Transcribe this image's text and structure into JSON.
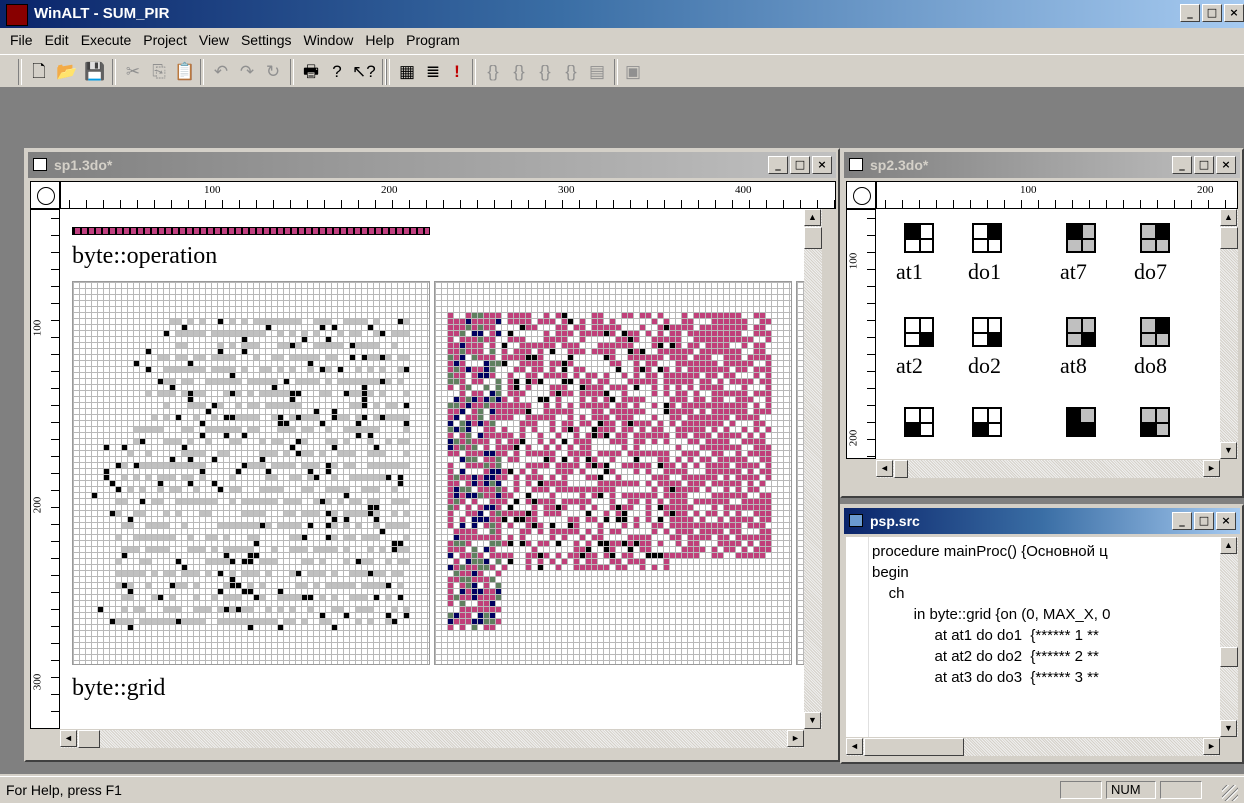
{
  "app": {
    "title": "WinALT - SUM_PIR"
  },
  "menu": [
    "File",
    "Edit",
    "Execute",
    "Project",
    "View",
    "Settings",
    "Window",
    "Help",
    "Program"
  ],
  "toolbar": {
    "icons": [
      "new-file-icon",
      "open-folder-icon",
      "save-icon",
      "cut-icon",
      "copy-icon",
      "paste-icon",
      "undo-icon",
      "redo-icon",
      "refresh-icon",
      "print-icon",
      "help-icon",
      "context-help-icon",
      "grid-icon",
      "step-icon",
      "run-icon",
      "step-into-icon",
      "step-over-icon",
      "step-out-icon",
      "run-to-cursor-icon",
      "breakpoints-icon",
      "stop-icon"
    ]
  },
  "win1": {
    "title": "sp1.3do*",
    "ruler_top": [
      "100",
      "200",
      "300",
      "400"
    ],
    "ruler_left": [
      "100",
      "200",
      "300"
    ],
    "label_operation": "byte::operation",
    "label_grid": "byte::grid"
  },
  "win2": {
    "title": "sp2.3do*",
    "ruler_top": [
      "100",
      "200"
    ],
    "ruler_left": [
      "100",
      "200"
    ],
    "cells": [
      "at1",
      "do1",
      "at7",
      "do7",
      "at2",
      "do2",
      "at8",
      "do8"
    ]
  },
  "win3": {
    "title": "psp.src",
    "lines": [
      "procedure mainProc() {Основной ц",
      "begin",
      "    ch",
      "          in byte::grid {on (0, MAX_X, 0",
      "               at at1 do do1  {****** 1 **",
      "               at at2 do do2  {****** 2 **",
      "               at at3 do do3  {****** 3 **"
    ]
  },
  "status": {
    "text": "For Help, press F1",
    "num": "NUM"
  },
  "colors": {
    "title_active": "#0a246a",
    "cell_magenta": "#c0407a",
    "cell_navy": "#000060",
    "cell_black": "#000000",
    "cell_gray": "#c0c0c0"
  }
}
